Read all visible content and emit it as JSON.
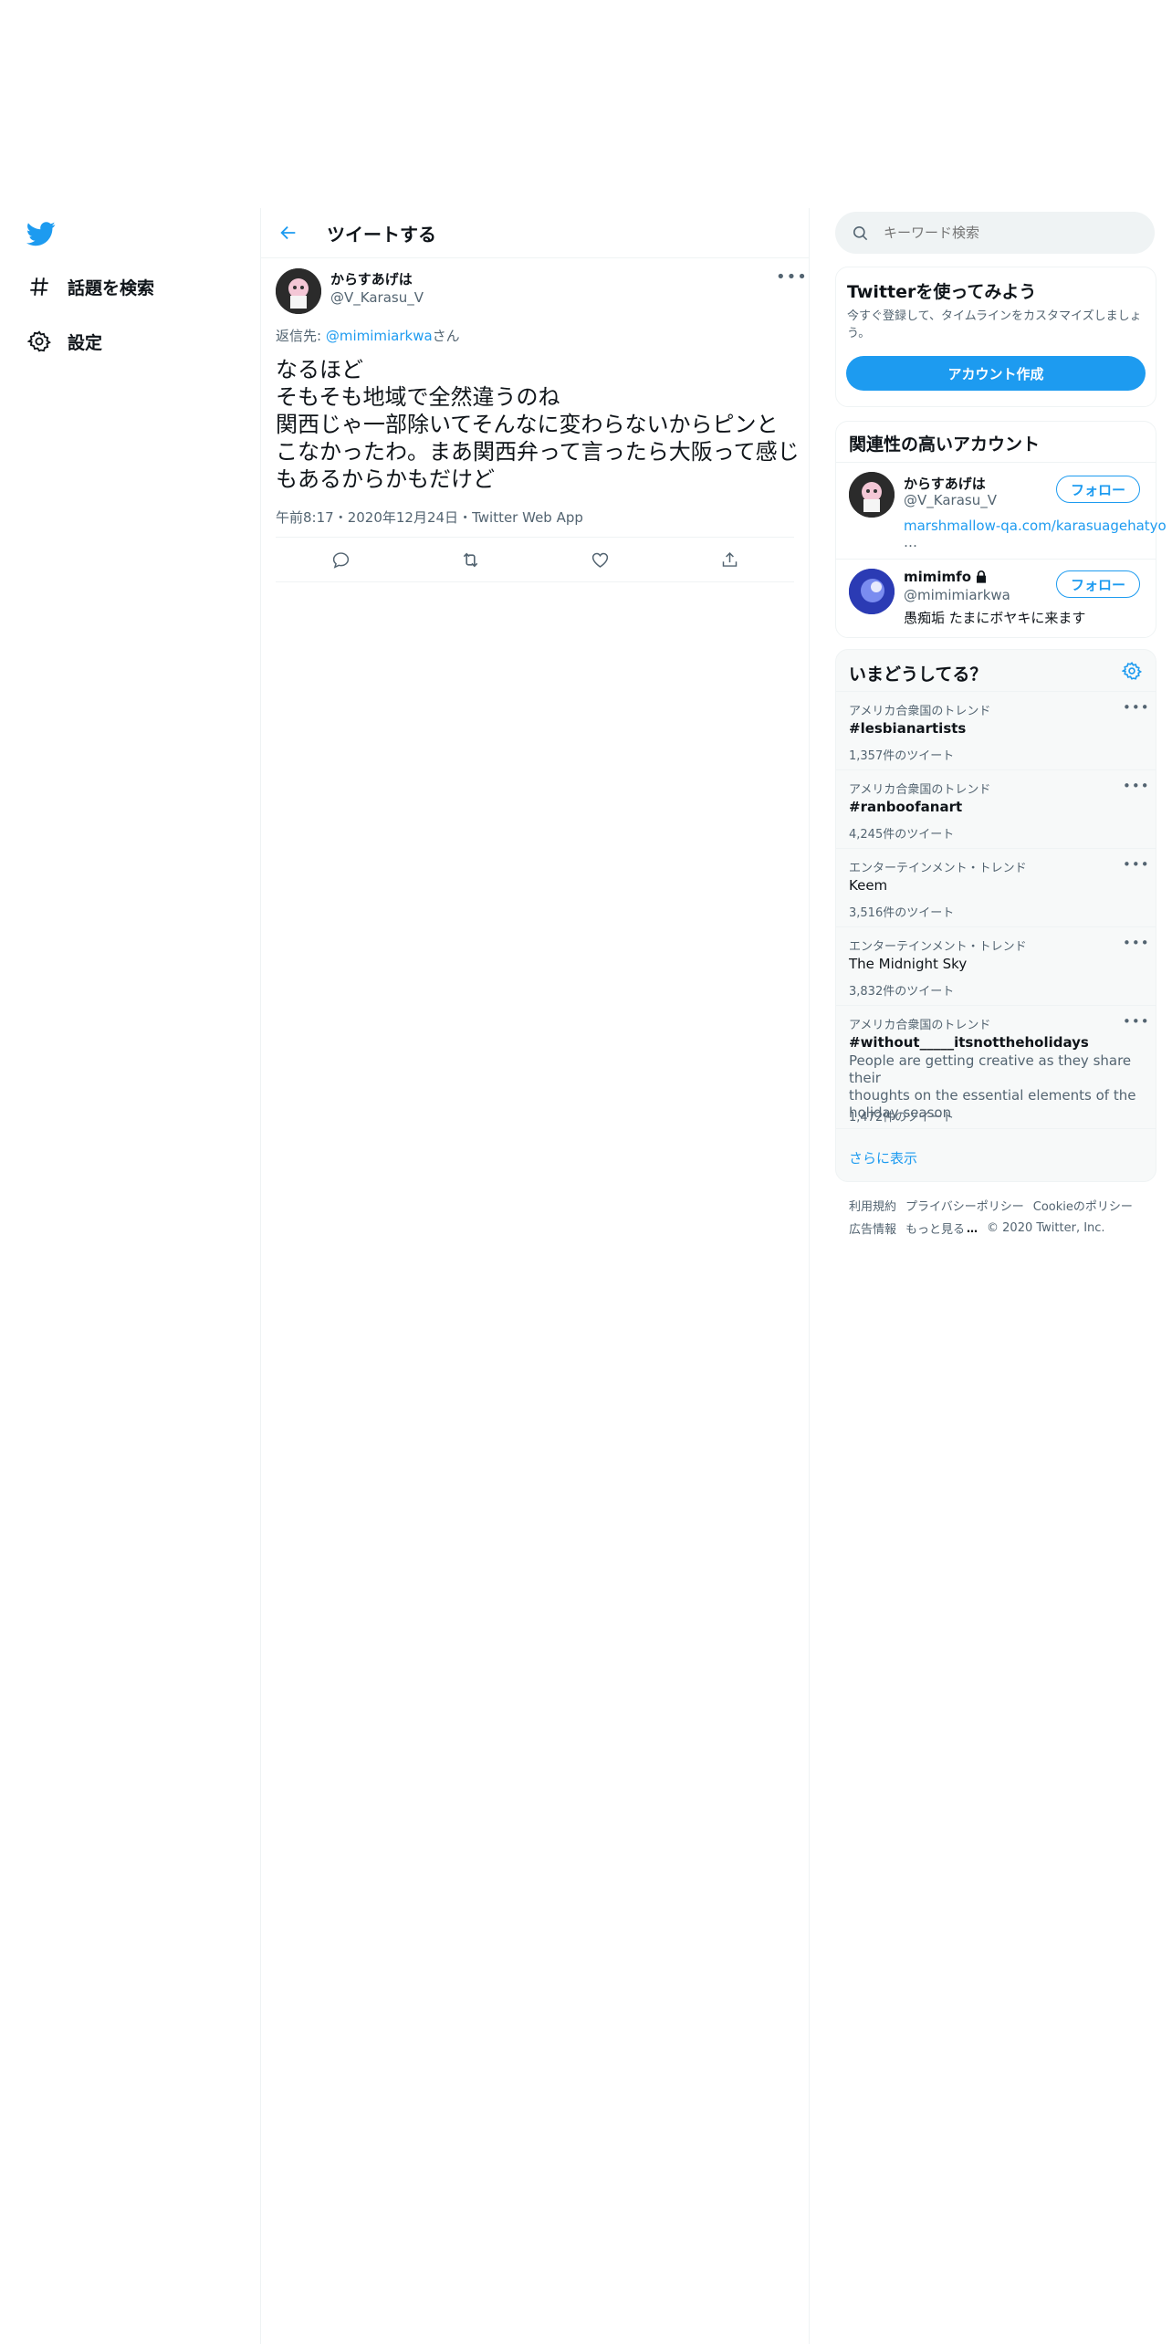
{
  "nav": {
    "explore_label": "話題を検索",
    "settings_label": "設定"
  },
  "header": {
    "title": "ツイートする"
  },
  "tweet": {
    "display_name": "からすあげは",
    "handle": "@V_Karasu_V",
    "reply_prefix": "返信先: ",
    "reply_to": "@mimimiarkwa",
    "reply_suffix": "さん",
    "lines": [
      "なるほど",
      "そもそも地域で全然違うのね",
      "関西じゃ一部除いてそんなに変わらないからピンと",
      "こなかったわ。まあ関西弁って言ったら大阪って感じ",
      "もあるからかもだけど"
    ],
    "time": "午前8:17",
    "sep": "・",
    "date": "2020年12月24日",
    "source": "Twitter Web App"
  },
  "search": {
    "placeholder": "キーワード検索"
  },
  "signup_card": {
    "title": "Twitterを使ってみよう",
    "desc": "今すぐ登録して、タイムラインをカスタマイズしましょう。",
    "button": "アカウント作成"
  },
  "related": {
    "title": "関連性の高いアカウント",
    "accounts": [
      {
        "name": "からすあげは",
        "handle": "@V_Karasu_V",
        "bio": "marshmallow-qa.com/karasuagehatyo",
        "bio_more": "…",
        "follow": "フォロー"
      },
      {
        "name": "mimimfo",
        "handle": "@mimimiarkwa",
        "bio": "愚痴垢 たまにボヤキに来ます",
        "follow": "フォロー"
      }
    ]
  },
  "trends": {
    "title": "いまどうしてる？",
    "items": [
      {
        "context": "アメリカ合衆国のトレンド",
        "name": "#lesbianartists",
        "count": "1,357件のツイート"
      },
      {
        "context": "アメリカ合衆国のトレンド",
        "name": "#ranboofanart",
        "count": "4,245件のツイート"
      },
      {
        "context": "エンターテインメント・トレンド",
        "name": "Keem",
        "count": "3,516件のツイート"
      },
      {
        "context": "エンターテインメント・トレンド",
        "name": "The Midnight Sky",
        "count": "3,832件のツイート"
      },
      {
        "context": "アメリカ合衆国のトレンド",
        "name": "#without_____itsnottheholidays",
        "desc": [
          "People are getting creative as they share their",
          "thoughts on the essential elements of the",
          "holiday season"
        ],
        "count": "1,472件のツイート"
      }
    ],
    "show_more": "さらに表示"
  },
  "footer": {
    "terms": "利用規約",
    "privacy": "プライバシーポリシー",
    "cookie": "Cookieのポリシー",
    "ads": "広告情報",
    "more": "もっと見る",
    "copyright": "© 2020 Twitter, Inc."
  },
  "colors": {
    "accent": "#1d9bf0",
    "muted": "#536471",
    "text": "#0f1419"
  }
}
